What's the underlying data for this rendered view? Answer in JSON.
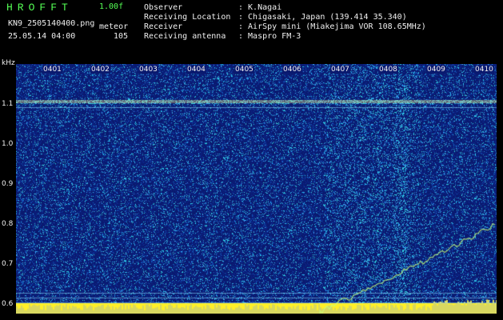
{
  "app": {
    "name": "HROFFT",
    "version": "1.00f"
  },
  "file": {
    "name": "KN9_2505140400.png",
    "datetime": "25.05.14 04:00"
  },
  "meteor": {
    "label": "meteor",
    "count": "105"
  },
  "info": [
    {
      "key": "Observer",
      "value": ": K.Nagai"
    },
    {
      "key": "Receiving Location",
      "value": ": Chigasaki, Japan (139.414 35.340)"
    },
    {
      "key": "Receiver",
      "value": ": AirSpy mini (Miakejima VOR 108.65MHz)"
    },
    {
      "key": "Receiving antenna",
      "value": ": Maspro FM-3"
    }
  ],
  "axis": {
    "unit": "kHz",
    "y_ticks": [
      "1.1",
      "1.0",
      "0.9",
      "0.8",
      "0.7",
      "0.6"
    ],
    "x_ticks": [
      "0401",
      "0402",
      "0403",
      "0404",
      "0405",
      "0406",
      "0407",
      "0408",
      "0409",
      "0410"
    ]
  },
  "colors": {
    "background": "#000000",
    "waterfall": "#0a1a70",
    "accent": "#55ff55",
    "text": "#f0f0f0"
  }
}
